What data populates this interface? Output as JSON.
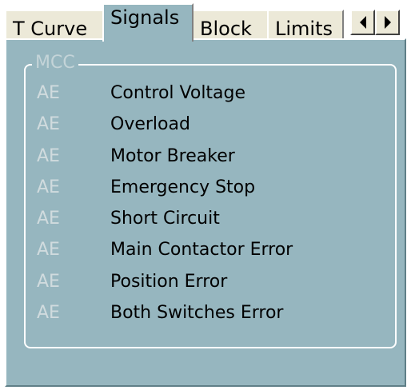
{
  "tabs": [
    {
      "label": "T Curve",
      "active": false
    },
    {
      "label": "Signals",
      "active": true
    },
    {
      "label": "Block",
      "active": false
    },
    {
      "label": "Limits",
      "active": false
    }
  ],
  "tab_scroll": {
    "left_icon": "arrow-left-icon",
    "right_icon": "arrow-right-icon"
  },
  "group": {
    "title": "MCC",
    "signals": [
      {
        "code": "AE",
        "name": "Control Voltage"
      },
      {
        "code": "AE",
        "name": "Overload"
      },
      {
        "code": "AE",
        "name": "Motor Breaker"
      },
      {
        "code": "AE",
        "name": "Emergency Stop"
      },
      {
        "code": "AE",
        "name": "Short Circuit"
      },
      {
        "code": "AE",
        "name": "Main Contactor Error"
      },
      {
        "code": "AE",
        "name": "Position Error"
      },
      {
        "code": "AE",
        "name": "Both Switches Error"
      }
    ]
  },
  "colors": {
    "panel_bg": "#96b6bf",
    "tab_bg": "#ece9d8",
    "code_text": "#d0dbde",
    "label_text": "#000000"
  }
}
